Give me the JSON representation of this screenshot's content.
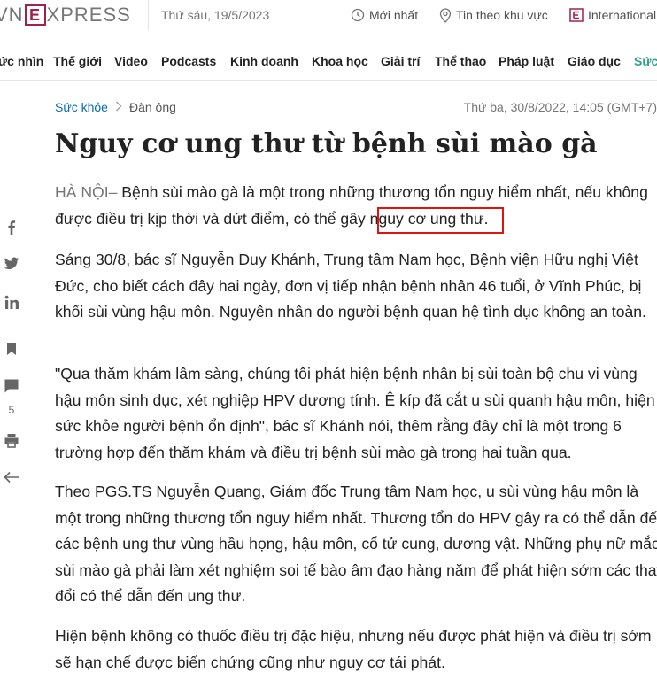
{
  "header": {
    "logo_text": [
      "VN",
      "E",
      "XPRESS"
    ],
    "date": "Thứ sáu, 19/5/2023",
    "latest": "Mới nhất",
    "local_news": "Tin theo khu vực",
    "international": "International"
  },
  "nav": [
    "ức nhìn",
    "Thế giới",
    "Video",
    "Podcasts",
    "Kinh doanh",
    "Khoa học",
    "Giải trí",
    "Thể thao",
    "Pháp luật",
    "Giáo dục",
    "Sức"
  ],
  "sidebar": {
    "comment_count": "5"
  },
  "article": {
    "breadcrumb": [
      "Sức khỏe",
      "Đàn ông"
    ],
    "published": "Thứ ba, 30/8/2022, 14:05 (GMT+7)",
    "title": "Nguy cơ ung thư từ bệnh sùi mào gà",
    "lead_location": "HÀ NỘI",
    "lead_sep": "–",
    "lead_text_before": " Bệnh sùi mào gà là một trong những thương tổn nguy hiểm nhất, nếu không được điều trị kịp thời và dứt điểm, có thể gây ",
    "lead_text_highlight": "nguy cơ ung thư.",
    "paragraphs": [
      "Sáng 30/8, bác sĩ Nguyễn Duy Khánh, Trung tâm Nam học, Bệnh viện Hữu nghị Việt Đức, cho biết cách đây hai ngày, đơn vị tiếp nhận bệnh nhân 46 tuổi, ở Vĩnh Phúc, bị khối sùi vùng hậu môn. Nguyên nhân do người bệnh quan hệ tình dục không an toàn.",
      "\"Qua thăm khám lâm sàng, chúng tôi phát hiện bệnh nhân bị sùi toàn bộ chu vi vùng hậu môn sinh dục, xét nghiệp HPV dương tính. Ê kíp đã cắt u sùi quanh hậu môn, hiện sức khỏe người bệnh ổn định\", bác sĩ Khánh nói, thêm rằng đây chỉ là một trong 6 trường hợp đến thăm khám và điều trị bệnh sùi mào gà trong hai tuần qua.",
      "Theo PGS.TS Nguyễn Quang, Giám đốc Trung tâm Nam học, u sùi vùng hậu môn là một trong những thương tổn nguy hiểm nhất. Thương tổn do HPV gây ra có thể dẫn đến các bệnh ung thư vùng hầu họng, hậu môn, cổ tử cung, dương vật. Những phụ nữ mắc sùi mào gà phải làm xét nghiệm soi tế bào âm đạo hàng năm để phát hiện sớm các thay đổi có thể dẫn đến ung thư.",
      "Hiện bệnh không có thuốc điều trị đặc hiệu, nhưng nếu được phát hiện và điều trị sớm sẽ hạn chế được biến chứng cũng như nguy cơ tái phát."
    ]
  },
  "colors": {
    "brand": "#9f224e",
    "link": "#076db6",
    "highlight_border": "#e01212",
    "nav_accent": "#2ea38a"
  }
}
